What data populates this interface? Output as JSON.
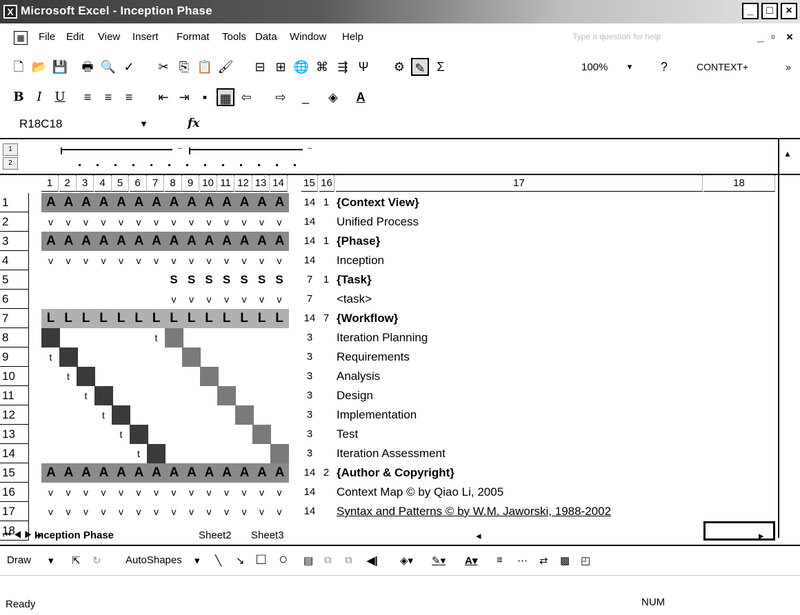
{
  "window": {
    "title": "Microsoft Excel - Inception Phase"
  },
  "menu": [
    "File",
    "Edit",
    "View",
    "Insert",
    "Format",
    "Tools",
    "Data",
    "Window",
    "Help"
  ],
  "help_placeholder": "Type a question for help",
  "toolbar": {
    "zoom": "100%",
    "context": "CONTEXT+"
  },
  "formula_bar": {
    "name_box": "R18C18",
    "fx": "fx"
  },
  "outline_levels": [
    "1",
    "2"
  ],
  "columns": [
    "1",
    "2",
    "3",
    "4",
    "5",
    "6",
    "7",
    "8",
    "9",
    "10",
    "11",
    "12",
    "13",
    "14",
    "15",
    "16",
    "17",
    "18"
  ],
  "rows": [
    {
      "n": "1",
      "cells": [
        "A",
        "A",
        "A",
        "A",
        "A",
        "A",
        "A",
        "A",
        "A",
        "A",
        "A",
        "A",
        "A",
        "A"
      ],
      "style": "a",
      "c15": "14",
      "c16": "1",
      "label": "{Context View}",
      "bold": true
    },
    {
      "n": "2",
      "cells": [
        "v",
        "v",
        "v",
        "v",
        "v",
        "v",
        "v",
        "v",
        "v",
        "v",
        "v",
        "v",
        "v",
        "v"
      ],
      "style": "plain",
      "c15": "14",
      "c16": "",
      "label": "Unified Process",
      "bold": false
    },
    {
      "n": "3",
      "cells": [
        "A",
        "A",
        "A",
        "A",
        "A",
        "A",
        "A",
        "A",
        "A",
        "A",
        "A",
        "A",
        "A",
        "A"
      ],
      "style": "a",
      "c15": "14",
      "c16": "1",
      "label": "{Phase}",
      "bold": true
    },
    {
      "n": "4",
      "cells": [
        "v",
        "v",
        "v",
        "v",
        "v",
        "v",
        "v",
        "v",
        "v",
        "v",
        "v",
        "v",
        "v",
        "v"
      ],
      "style": "plain",
      "c15": "14",
      "c16": "",
      "label": "Inception",
      "bold": false
    },
    {
      "n": "5",
      "cells": [
        "",
        "",
        "",
        "",
        "",
        "",
        "",
        "S",
        "S",
        "S",
        "S",
        "S",
        "S",
        "S"
      ],
      "style": "s",
      "c15": "7",
      "c16": "1",
      "label": "{Task}",
      "bold": true
    },
    {
      "n": "6",
      "cells": [
        "",
        "",
        "",
        "",
        "",
        "",
        "",
        "v",
        "v",
        "v",
        "v",
        "v",
        "v",
        "v"
      ],
      "style": "plain",
      "c15": "7",
      "c16": "",
      "label": "<task>",
      "bold": false
    },
    {
      "n": "7",
      "cells": [
        "L",
        "L",
        "L",
        "L",
        "L",
        "L",
        "L",
        "L",
        "L",
        "L",
        "L",
        "L",
        "L",
        "L"
      ],
      "style": "l",
      "c15": "14",
      "c16": "7",
      "label": "{Workflow}",
      "bold": true
    },
    {
      "n": "8",
      "cells": [
        "",
        "",
        "",
        "",
        "",
        "",
        "t",
        "",
        "",
        "",
        "",
        "",
        "",
        ""
      ],
      "style": "diag",
      "c15": "3",
      "c16": "",
      "label": "Iteration Planning",
      "bold": false,
      "dark": [
        0
      ],
      "mid": [
        7
      ]
    },
    {
      "n": "9",
      "cells": [
        "t",
        "",
        "",
        "",
        "",
        "",
        "",
        "",
        "",
        "",
        "",
        "",
        "",
        ""
      ],
      "style": "diag",
      "c15": "3",
      "c16": "",
      "label": "Requirements",
      "bold": false,
      "dark": [
        1
      ],
      "mid": [
        8
      ]
    },
    {
      "n": "10",
      "cells": [
        "",
        "t",
        "",
        "",
        "",
        "",
        "",
        "",
        "",
        "",
        "",
        "",
        "",
        ""
      ],
      "style": "diag",
      "c15": "3",
      "c16": "",
      "label": "Analysis",
      "bold": false,
      "dark": [
        2
      ],
      "mid": [
        9
      ]
    },
    {
      "n": "11",
      "cells": [
        "",
        "",
        "t",
        "",
        "",
        "",
        "",
        "",
        "",
        "",
        "",
        "",
        "",
        ""
      ],
      "style": "diag",
      "c15": "3",
      "c16": "",
      "label": "Design",
      "bold": false,
      "dark": [
        3
      ],
      "mid": [
        10
      ]
    },
    {
      "n": "12",
      "cells": [
        "",
        "",
        "",
        "t",
        "",
        "",
        "",
        "",
        "",
        "",
        "",
        "",
        "",
        ""
      ],
      "style": "diag",
      "c15": "3",
      "c16": "",
      "label": "Implementation",
      "bold": false,
      "dark": [
        4
      ],
      "mid": [
        11
      ]
    },
    {
      "n": "13",
      "cells": [
        "",
        "",
        "",
        "",
        "t",
        "",
        "",
        "",
        "",
        "",
        "",
        "",
        "",
        ""
      ],
      "style": "diag",
      "c15": "3",
      "c16": "",
      "label": "Test",
      "bold": false,
      "dark": [
        5
      ],
      "mid": [
        12
      ]
    },
    {
      "n": "14",
      "cells": [
        "",
        "",
        "",
        "",
        "",
        "t",
        "",
        "",
        "",
        "",
        "",
        "",
        "",
        ""
      ],
      "style": "diag",
      "c15": "3",
      "c16": "",
      "label": "Iteration Assessment",
      "bold": false,
      "dark": [
        6
      ],
      "mid": [
        13
      ]
    },
    {
      "n": "15",
      "cells": [
        "A",
        "A",
        "A",
        "A",
        "A",
        "A",
        "A",
        "A",
        "A",
        "A",
        "A",
        "A",
        "A",
        "A"
      ],
      "style": "a",
      "c15": "14",
      "c16": "2",
      "label": "{Author & Copyright}",
      "bold": true
    },
    {
      "n": "16",
      "cells": [
        "v",
        "v",
        "v",
        "v",
        "v",
        "v",
        "v",
        "v",
        "v",
        "v",
        "v",
        "v",
        "v",
        "v"
      ],
      "style": "plain",
      "c15": "14",
      "c16": "",
      "label": "Context Map © by Qiao Li, 2005",
      "bold": false
    },
    {
      "n": "17",
      "cells": [
        "v",
        "v",
        "v",
        "v",
        "v",
        "v",
        "v",
        "v",
        "v",
        "v",
        "v",
        "v",
        "v",
        "v"
      ],
      "style": "plain",
      "c15": "14",
      "c16": "",
      "label": "Syntax and Patterns © by W.M. Jaworski, 1988-2002",
      "bold": false,
      "link": true
    },
    {
      "n": "18",
      "cells": [
        "",
        "",
        "",
        "",
        "",
        "",
        "",
        "",
        "",
        "",
        "",
        "",
        "",
        ""
      ],
      "style": "plain",
      "c15": "",
      "c16": "",
      "label": "",
      "bold": false
    }
  ],
  "sheet_tabs": [
    "Inception Phase",
    "Sheet2",
    "Sheet3"
  ],
  "drawbar": {
    "draw": "Draw",
    "autoshapes": "AutoShapes"
  },
  "status": {
    "ready": "Ready",
    "num": "NUM"
  }
}
